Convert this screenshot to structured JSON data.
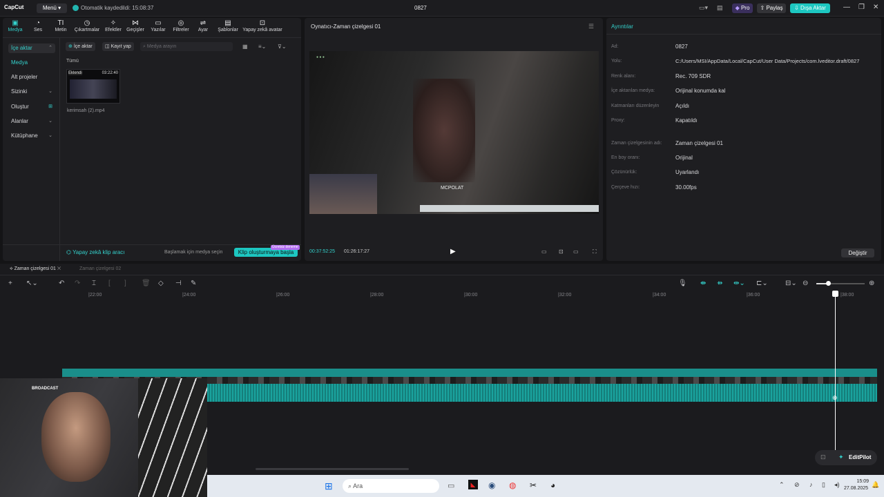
{
  "titlebar": {
    "app_name": "CapCut",
    "menu_label": "Menü",
    "autosave_text": "Otomatik kaydedildi: 15:08:37",
    "project_title": "0827",
    "pro_label": "Pro",
    "share_label": "Paylaş",
    "export_label": "Dışa Aktar"
  },
  "toolbar": {
    "items": [
      {
        "label": "Medya",
        "icon": "media-icon"
      },
      {
        "label": "Ses",
        "icon": "audio-icon"
      },
      {
        "label": "Metin",
        "icon": "text-icon"
      },
      {
        "label": "Çıkartmalar",
        "icon": "sticker-icon"
      },
      {
        "label": "Efektler",
        "icon": "effects-icon"
      },
      {
        "label": "Geçişler",
        "icon": "transitions-icon"
      },
      {
        "label": "Yazılar",
        "icon": "captions-icon"
      },
      {
        "label": "Filtreler",
        "icon": "filters-icon"
      },
      {
        "label": "Ayar",
        "icon": "adjust-icon"
      },
      {
        "label": "Şablonlar",
        "icon": "templates-icon"
      },
      {
        "label": "Yapay zekâ avatar",
        "icon": "ai-avatar-icon"
      }
    ]
  },
  "sidebar": {
    "items": [
      {
        "label": "İçe aktar"
      },
      {
        "label": "Medya"
      },
      {
        "label": "Alt projeler"
      },
      {
        "label": "Sizinki"
      },
      {
        "label": "Oluştur"
      },
      {
        "label": "Alanlar"
      },
      {
        "label": "Kütüphane"
      }
    ]
  },
  "media": {
    "import_label": "İçe aktar",
    "record_label": "Kayıt yap",
    "search_placeholder": "Medya arayın",
    "filter_all": "Tümü",
    "clip_badge": "Eklendi",
    "clip_duration": "03:22:40",
    "clip_name": "kerimsah (2).mp4",
    "ai_clip_tool": "Yapay zekâ klip aracı",
    "hint": "Başlamak için medya seçin",
    "create_clip_button": "Klip oluşturmaya başla",
    "create_clip_tag": "Ücretsiz deneme"
  },
  "player": {
    "title": "Oynatıcı-Zaman çizelgesi 01",
    "current_time": "00:37:52:25",
    "total_time": "01:26:17:27",
    "overlay_name": "MCPOLAT"
  },
  "details": {
    "title": "Ayrıntılar",
    "rows": [
      {
        "label": "Ad:",
        "value": "0827"
      },
      {
        "label": "Yolu:",
        "value": "C:/Users/MSI/AppData/Local/CapCut/User Data/Projects/com.lveditor.draft/0827"
      },
      {
        "label": "Renk alanı:",
        "value": "Rec. 709 SDR"
      },
      {
        "label": "İçe aktarılan medya:",
        "value": "Orijinal konumda kal"
      },
      {
        "label": "Katmanları düzenleyin",
        "value": "Açıldı"
      },
      {
        "label": "Proxy:",
        "value": "Kapatıldı"
      },
      {
        "label": "Zaman çizelgesinin adı:",
        "value": "Zaman çizelgesi 01"
      },
      {
        "label": "En boy oranı:",
        "value": "Orijinal"
      },
      {
        "label": "Çözünürlük:",
        "value": "Uyarlandı"
      },
      {
        "label": "Çerçeve hızı:",
        "value": "30.00fps"
      }
    ],
    "change_button": "Değiştir"
  },
  "timeline": {
    "tab_active": "Zaman çizelgesi 01",
    "tab_other": "Zaman çizelgesi 02",
    "ruler": [
      "|22:00",
      "|24:00",
      "|26:00",
      "|28:00",
      "|30:00",
      "|32:00",
      "|34:00",
      "|36:00",
      "|38:00"
    ],
    "editpilot_label": "EditPilot"
  },
  "taskbar": {
    "search_placeholder": "Ara",
    "clock_time": "15:09",
    "clock_date": "27.08.2025"
  },
  "webcam": {
    "label": "BROADCAST"
  },
  "colors": {
    "accent": "#22b5b0",
    "export_bg": "#1dc7c1"
  }
}
